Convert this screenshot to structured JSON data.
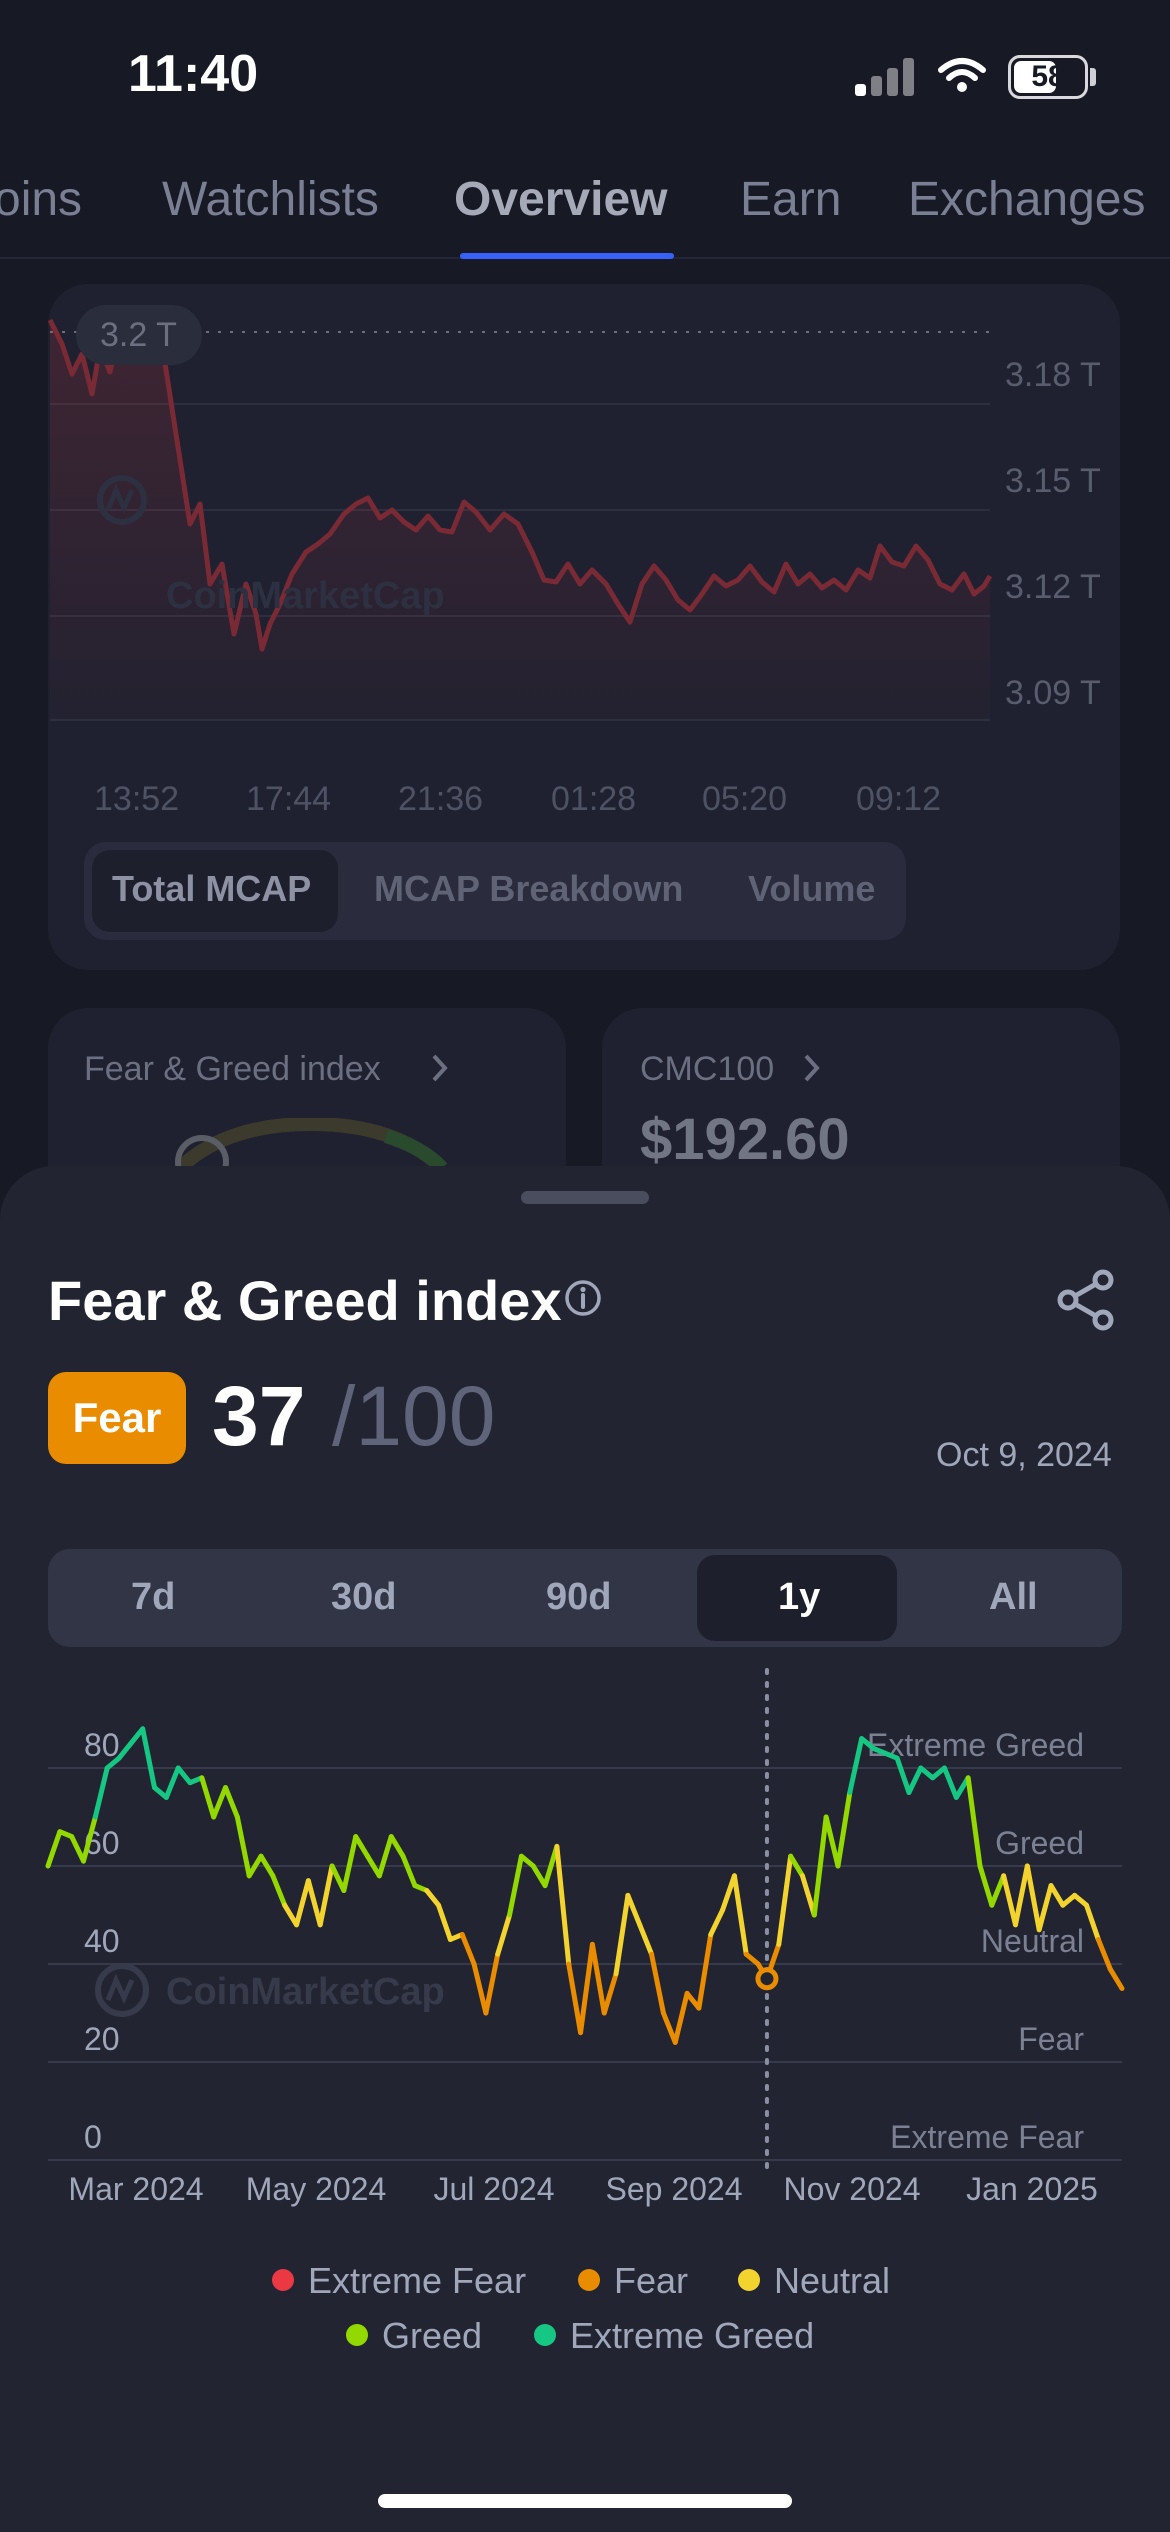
{
  "status_bar": {
    "time": "11:40",
    "battery": "58"
  },
  "tabs": [
    {
      "label": "oins"
    },
    {
      "label": "Watchlists"
    },
    {
      "label": "Overview",
      "active": true
    },
    {
      "label": "Earn"
    },
    {
      "label": "Exchanges"
    }
  ],
  "mcap_card": {
    "badge": "3.2 T",
    "watermark": "CoinMarketCap",
    "y_ticks": [
      "3.18 T",
      "3.15 T",
      "3.12 T",
      "3.09 T"
    ],
    "x_ticks": [
      "13:52",
      "17:44",
      "21:36",
      "01:28",
      "05:20",
      "09:12"
    ],
    "segments": [
      "Total MCAP",
      "MCAP Breakdown",
      "Volume"
    ]
  },
  "fear_greed_card": {
    "title": "Fear & Greed index"
  },
  "cmc100_card": {
    "title": "CMC100",
    "value": "$192.60"
  },
  "sheet": {
    "title": "Fear & Greed index",
    "badge": "Fear",
    "value": "37",
    "max": "/100",
    "date": "Oct 9, 2024",
    "ranges": [
      "7d",
      "30d",
      "90d",
      "1y",
      "All"
    ],
    "active_range": "1y",
    "watermark": "CoinMarketCap"
  },
  "colors": {
    "extreme_fear": "#ea3943",
    "fear": "#ea8c00",
    "neutral": "#f3d42f",
    "greed": "#93d900",
    "extreme_greed": "#16c784"
  },
  "chart_data": {
    "type": "line",
    "x_labels": [
      "Mar 2024",
      "May 2024",
      "Jul 2024",
      "Sep 2024",
      "Nov 2024",
      "Jan 2025"
    ],
    "y_ticks": [
      "0",
      "20",
      "40",
      "60",
      "80"
    ],
    "zone_labels": [
      "Extreme Greed",
      "Greed",
      "Neutral",
      "Fear",
      "Extreme Fear"
    ],
    "ylim": [
      0,
      100
    ],
    "selected": {
      "date": "Oct 9, 2024",
      "value": 37
    },
    "legend": [
      "Extreme Fear",
      "Fear",
      "Neutral",
      "Greed",
      "Extreme Greed"
    ],
    "points": [
      [
        "2024-02-09",
        60
      ],
      [
        "2024-02-13",
        67
      ],
      [
        "2024-02-17",
        66
      ],
      [
        "2024-02-21",
        61
      ],
      [
        "2024-02-25",
        70
      ],
      [
        "2024-02-29",
        80
      ],
      [
        "2024-03-04",
        82
      ],
      [
        "2024-03-08",
        85
      ],
      [
        "2024-03-12",
        88
      ],
      [
        "2024-03-16",
        76
      ],
      [
        "2024-03-20",
        74
      ],
      [
        "2024-03-24",
        80
      ],
      [
        "2024-03-28",
        77
      ],
      [
        "2024-04-01",
        78
      ],
      [
        "2024-04-05",
        70
      ],
      [
        "2024-04-09",
        76
      ],
      [
        "2024-04-13",
        70
      ],
      [
        "2024-04-17",
        58
      ],
      [
        "2024-04-21",
        62
      ],
      [
        "2024-04-25",
        58
      ],
      [
        "2024-04-29",
        52
      ],
      [
        "2024-05-03",
        48
      ],
      [
        "2024-05-07",
        57
      ],
      [
        "2024-05-11",
        48
      ],
      [
        "2024-05-15",
        60
      ],
      [
        "2024-05-19",
        55
      ],
      [
        "2024-05-23",
        66
      ],
      [
        "2024-05-27",
        62
      ],
      [
        "2024-05-31",
        58
      ],
      [
        "2024-06-04",
        66
      ],
      [
        "2024-06-08",
        62
      ],
      [
        "2024-06-12",
        56
      ],
      [
        "2024-06-16",
        55
      ],
      [
        "2024-06-20",
        52
      ],
      [
        "2024-06-24",
        45
      ],
      [
        "2024-06-28",
        46
      ],
      [
        "2024-07-02",
        40
      ],
      [
        "2024-07-06",
        30
      ],
      [
        "2024-07-10",
        42
      ],
      [
        "2024-07-14",
        50
      ],
      [
        "2024-07-18",
        62
      ],
      [
        "2024-07-22",
        60
      ],
      [
        "2024-07-26",
        56
      ],
      [
        "2024-07-30",
        64
      ],
      [
        "2024-08-03",
        40
      ],
      [
        "2024-08-07",
        26
      ],
      [
        "2024-08-11",
        44
      ],
      [
        "2024-08-15",
        30
      ],
      [
        "2024-08-19",
        38
      ],
      [
        "2024-08-23",
        54
      ],
      [
        "2024-08-27",
        48
      ],
      [
        "2024-08-31",
        42
      ],
      [
        "2024-09-04",
        30
      ],
      [
        "2024-09-08",
        24
      ],
      [
        "2024-09-12",
        34
      ],
      [
        "2024-09-16",
        31
      ],
      [
        "2024-09-20",
        46
      ],
      [
        "2024-09-24",
        51
      ],
      [
        "2024-09-28",
        58
      ],
      [
        "2024-10-02",
        42
      ],
      [
        "2024-10-06",
        40
      ],
      [
        "2024-10-09",
        37
      ],
      [
        "2024-10-13",
        44
      ],
      [
        "2024-10-17",
        62
      ],
      [
        "2024-10-21",
        58
      ],
      [
        "2024-10-25",
        50
      ],
      [
        "2024-10-29",
        70
      ],
      [
        "2024-11-02",
        60
      ],
      [
        "2024-11-06",
        75
      ],
      [
        "2024-11-10",
        86
      ],
      [
        "2024-11-14",
        84
      ],
      [
        "2024-11-18",
        83
      ],
      [
        "2024-11-22",
        82
      ],
      [
        "2024-11-26",
        75
      ],
      [
        "2024-11-30",
        80
      ],
      [
        "2024-12-04",
        78
      ],
      [
        "2024-12-08",
        80
      ],
      [
        "2024-12-12",
        74
      ],
      [
        "2024-12-16",
        78
      ],
      [
        "2024-12-20",
        60
      ],
      [
        "2024-12-24",
        52
      ],
      [
        "2024-12-28",
        58
      ],
      [
        "2025-01-01",
        48
      ],
      [
        "2025-01-05",
        60
      ],
      [
        "2025-01-09",
        47
      ],
      [
        "2025-01-13",
        56
      ],
      [
        "2025-01-17",
        52
      ],
      [
        "2025-01-21",
        54
      ],
      [
        "2025-01-25",
        52
      ],
      [
        "2025-01-29",
        45
      ],
      [
        "2025-02-02",
        39
      ],
      [
        "2025-02-06",
        35
      ]
    ]
  }
}
